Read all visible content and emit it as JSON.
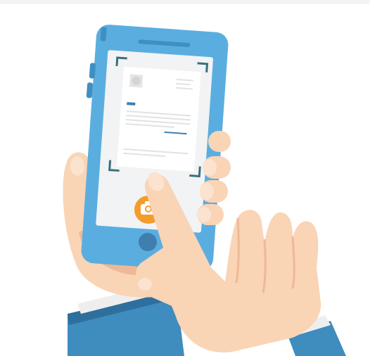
{
  "illustration": {
    "colors": {
      "phone_body": "#5aaedf",
      "phone_shadow": "#3f8fc2",
      "screen": "#f2f3f4",
      "document": "#ffffff",
      "frame_corner": "#3a6e7e",
      "camera_button": "#f39c2a",
      "home_button": "#3f7fb0",
      "skin": "#f9d4b5",
      "skin_shade": "#efb896",
      "nail": "#fbe3cf",
      "sleeve": "#3f8cbf",
      "sleeve_dark": "#2f6f9e",
      "cuff": "#eeeeee"
    },
    "icons": {
      "camera": "camera-icon",
      "home": "home-button-icon"
    }
  }
}
